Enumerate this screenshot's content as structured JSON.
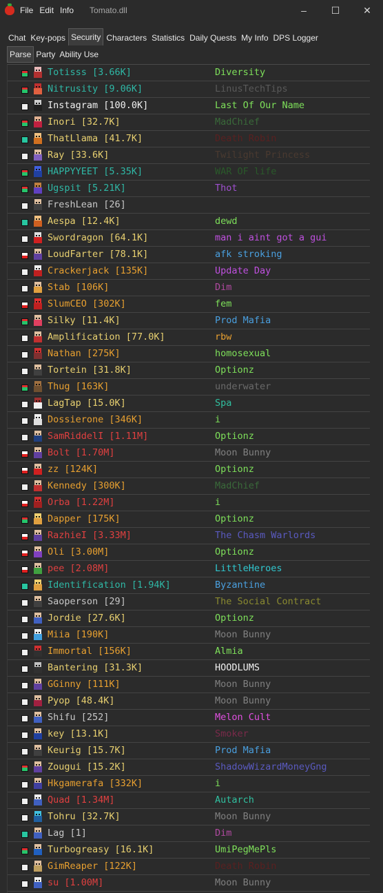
{
  "window": {
    "title": "Tomato.dll",
    "menu": [
      "File",
      "Edit",
      "Info"
    ],
    "controls": [
      "–",
      "☐",
      "✕"
    ]
  },
  "tabs": [
    {
      "label": "Chat"
    },
    {
      "label": "Key-pops"
    },
    {
      "label": "Security",
      "active": true
    },
    {
      "label": "Characters"
    },
    {
      "label": "Statistics"
    },
    {
      "label": "Daily Quests"
    },
    {
      "label": "My Info"
    },
    {
      "label": "DPS Logger"
    }
  ],
  "subtabs": [
    {
      "label": "Parse",
      "active": true
    },
    {
      "label": "Party"
    },
    {
      "label": "Ability Use"
    }
  ],
  "players": [
    {
      "name": "Totisss [3.66K]",
      "name_color": "#2fb8a6",
      "guild": "Diversity",
      "guild_color": "#7ee05a",
      "flag": "green",
      "skin": "#e8b8b8",
      "outfit": "#b03030"
    },
    {
      "name": "Nitrusity [9.06K]",
      "name_color": "#2fb8a6",
      "guild": "LinusTechTips",
      "guild_color": "#5a5a5a",
      "flag": "green",
      "skin": "#c03030",
      "outfit": "#e06040"
    },
    {
      "name": "Instagram [100.0K]",
      "name_color": "#f0f0f0",
      "guild": "Last Of Our Name",
      "guild_color": "#7ee05a",
      "flag": "white",
      "skin": "#d0d0d0",
      "outfit": "#202020"
    },
    {
      "name": "Inori [32.7K]",
      "name_color": "#e8d070",
      "guild": "MadChief",
      "guild_color": "#3a6a3a",
      "flag": "green",
      "skin": "#e0b090",
      "outfit": "#c02040"
    },
    {
      "name": "ThatLlama [41.7K]",
      "name_color": "#e8d070",
      "guild": "Death Robin",
      "guild_color": "#5a2020",
      "flag": "teal",
      "skin": "#f0c080",
      "outfit": "#d07020"
    },
    {
      "name": "Ray [33.6K]",
      "name_color": "#e8d070",
      "guild": "Twilight Princess",
      "guild_color": "#4a3a30",
      "flag": "white",
      "skin": "#e0c0a0",
      "outfit": "#8060c0"
    },
    {
      "name": "HAPPYYEET [5.35K]",
      "name_color": "#2fb8a6",
      "guild": "WAR OF life",
      "guild_color": "#2a5a2a",
      "flag": "green",
      "skin": "#4060e0",
      "outfit": "#2040a0"
    },
    {
      "name": "Ugspit [5.21K]",
      "name_color": "#2fb8a6",
      "guild": "Thot",
      "guild_color": "#a050d0",
      "flag": "green",
      "skin": "#c08040",
      "outfit": "#6040c0"
    },
    {
      "name": "FreshLean [26]",
      "name_color": "#c8c8c8",
      "guild": "",
      "guild_color": "#ffffff",
      "flag": "white",
      "skin": "#e0c0a0",
      "outfit": "#404040"
    },
    {
      "name": "Aespa [12.4K]",
      "name_color": "#e8d070",
      "guild": "dewd",
      "guild_color": "#7ee05a",
      "flag": "teal",
      "skin": "#f0c080",
      "outfit": "#d06020"
    },
    {
      "name": "Swordragon [64.1K]",
      "name_color": "#e8d070",
      "guild": "man i aint got a gui",
      "guild_color": "#c050e0",
      "flag": "white",
      "skin": "#e0e0e0",
      "outfit": "#d02020"
    },
    {
      "name": "LoudFarter [78.1K]",
      "name_color": "#e8d070",
      "guild": "afk stroking",
      "guild_color": "#4aa0e0",
      "flag": "red",
      "skin": "#e0c0a0",
      "outfit": "#6040a0"
    },
    {
      "name": "Crackerjack [135K]",
      "name_color": "#e8a030",
      "guild": "Update Day",
      "guild_color": "#c050e0",
      "flag": "white",
      "skin": "#f0f0f0",
      "outfit": "#c02020"
    },
    {
      "name": "Stab [106K]",
      "name_color": "#e8a030",
      "guild": "Dim",
      "guild_color": "#b04aa0",
      "flag": "white",
      "skin": "#e0c0a0",
      "outfit": "#e0a040"
    },
    {
      "name": "SlumCEO [302K]",
      "name_color": "#e8a030",
      "guild": "fem",
      "guild_color": "#7ee05a",
      "flag": "red",
      "skin": "#e03030",
      "outfit": "#c02020"
    },
    {
      "name": "Silky [11.4K]",
      "name_color": "#e8d070",
      "guild": "Prod Mafia",
      "guild_color": "#4aa0e0",
      "flag": "green",
      "skin": "#e0c0a0",
      "outfit": "#e04060"
    },
    {
      "name": "Amplification [77.0K]",
      "name_color": "#e8d070",
      "guild": "rbw",
      "guild_color": "#e8a030",
      "flag": "white",
      "skin": "#e0c0a0",
      "outfit": "#c03030"
    },
    {
      "name": "Nathan [275K]",
      "name_color": "#e8a030",
      "guild": "homosexual",
      "guild_color": "#7ee05a",
      "flag": "white",
      "skin": "#d03030",
      "outfit": "#803030"
    },
    {
      "name": "Tortein [31.8K]",
      "name_color": "#e8d070",
      "guild": "Optionz",
      "guild_color": "#7ee05a",
      "flag": "white",
      "skin": "#e0c0a0",
      "outfit": "#404040"
    },
    {
      "name": "Thug [163K]",
      "name_color": "#e8a030",
      "guild": "underwater",
      "guild_color": "#6a6a6a",
      "flag": "green",
      "skin": "#a07040",
      "outfit": "#705030"
    },
    {
      "name": "LagTap [15.0K]",
      "name_color": "#e8d070",
      "guild": "Spa",
      "guild_color": "#30c0a0",
      "flag": "white",
      "skin": "#a03030",
      "outfit": "#f0f0f0"
    },
    {
      "name": "Dossierone [346K]",
      "name_color": "#e8a030",
      "guild": "i",
      "guild_color": "#7ee05a",
      "flag": "white",
      "skin": "#f0f0f0",
      "outfit": "#e0e0e0"
    },
    {
      "name": "SamRiddelI [1.11M]",
      "name_color": "#e04040",
      "guild": "Optionz",
      "guild_color": "#7ee05a",
      "flag": "white",
      "skin": "#e0c0a0",
      "outfit": "#204080"
    },
    {
      "name": "Bolt [1.70M]",
      "name_color": "#e04040",
      "guild": "Moon Bunny",
      "guild_color": "#808080",
      "flag": "red",
      "skin": "#e0c0a0",
      "outfit": "#6040a0"
    },
    {
      "name": "zz [124K]",
      "name_color": "#e8a030",
      "guild": "Optionz",
      "guild_color": "#7ee05a",
      "flag": "red",
      "skin": "#e0c0a0",
      "outfit": "#d02020"
    },
    {
      "name": "Kennedy [300K]",
      "name_color": "#e8a030",
      "guild": "MadChief",
      "guild_color": "#3a6a3a",
      "flag": "white",
      "skin": "#e0c0a0",
      "outfit": "#c03030"
    },
    {
      "name": "Orba [1.22M]",
      "name_color": "#e04040",
      "guild": "i",
      "guild_color": "#7ee05a",
      "flag": "red",
      "skin": "#d03030",
      "outfit": "#a02020"
    },
    {
      "name": "Dapper [175K]",
      "name_color": "#e8a030",
      "guild": "Optionz",
      "guild_color": "#7ee05a",
      "flag": "green",
      "skin": "#f0d070",
      "outfit": "#e0a040"
    },
    {
      "name": "RazhieI [3.33M]",
      "name_color": "#e04040",
      "guild": "The Chasm Warlords",
      "guild_color": "#5a5ac0",
      "flag": "red",
      "skin": "#e0c0a0",
      "outfit": "#6040a0"
    },
    {
      "name": "Oli [3.00M]",
      "name_color": "#e8a030",
      "guild": "Optionz",
      "guild_color": "#7ee05a",
      "flag": "red",
      "skin": "#e0c0a0",
      "outfit": "#8040c0"
    },
    {
      "name": "pee [2.08M]",
      "name_color": "#e04040",
      "guild": "LittleHeroes",
      "guild_color": "#30c8d0",
      "flag": "red",
      "skin": "#e0c0a0",
      "outfit": "#40a040"
    },
    {
      "name": "Identification [1.94K]",
      "name_color": "#2fb8a6",
      "guild": "Byzantine",
      "guild_color": "#4aa0e0",
      "flag": "teal",
      "skin": "#f0d070",
      "outfit": "#e0a040"
    },
    {
      "name": "Saoperson [29]",
      "name_color": "#c8c8c8",
      "guild": "The Social Contract",
      "guild_color": "#8a8a30",
      "flag": "white",
      "skin": "#e0c0a0",
      "outfit": "#404040"
    },
    {
      "name": "Jordie [27.6K]",
      "name_color": "#e8d070",
      "guild": "Optionz",
      "guild_color": "#7ee05a",
      "flag": "white",
      "skin": "#e0c0a0",
      "outfit": "#4060c0"
    },
    {
      "name": "Miia [190K]",
      "name_color": "#e8a030",
      "guild": "Moon Bunny",
      "guild_color": "#808080",
      "flag": "white",
      "skin": "#f0f0f0",
      "outfit": "#40a0e0"
    },
    {
      "name": "Immortal [156K]",
      "name_color": "#e8a030",
      "guild": "Almia",
      "guild_color": "#7ee05a",
      "flag": "white",
      "skin": "#d03030",
      "outfit": "#303030"
    },
    {
      "name": "Bantering [31.3K]",
      "name_color": "#e8d070",
      "guild": "HOODLUMS",
      "guild_color": "#f0f0f0",
      "flag": "white",
      "skin": "#c0c0c0",
      "outfit": "#303030"
    },
    {
      "name": "GGinny [111K]",
      "name_color": "#e8a030",
      "guild": "Moon Bunny",
      "guild_color": "#808080",
      "flag": "white",
      "skin": "#e0c0a0",
      "outfit": "#6040a0"
    },
    {
      "name": "Pyop [48.4K]",
      "name_color": "#e8d070",
      "guild": "Moon Bunny",
      "guild_color": "#808080",
      "flag": "white",
      "skin": "#e0c0a0",
      "outfit": "#a02040"
    },
    {
      "name": "Shifu [252]",
      "name_color": "#c8c8c8",
      "guild": "Melon Cult",
      "guild_color": "#e050e0",
      "flag": "white",
      "skin": "#e0c0a0",
      "outfit": "#4060c0"
    },
    {
      "name": "key [13.1K]",
      "name_color": "#e8d070",
      "guild": "Smoker",
      "guild_color": "#7a2a4a",
      "flag": "white",
      "skin": "#e0c0a0",
      "outfit": "#2040a0"
    },
    {
      "name": "Keurig [15.7K]",
      "name_color": "#e8d070",
      "guild": "Prod Mafia",
      "guild_color": "#4aa0e0",
      "flag": "white",
      "skin": "#e0c0a0",
      "outfit": "#404040"
    },
    {
      "name": "Zougui [15.2K]",
      "name_color": "#e8d070",
      "guild": "ShadowWizardMoneyGng",
      "guild_color": "#5a5ac0",
      "flag": "green",
      "skin": "#e0c0a0",
      "outfit": "#6040a0"
    },
    {
      "name": "Hkgamerafa [332K]",
      "name_color": "#e8a030",
      "guild": "i",
      "guild_color": "#7ee05a",
      "flag": "white",
      "skin": "#e0c0a0",
      "outfit": "#4040a0"
    },
    {
      "name": "Quad [1.34M]",
      "name_color": "#e04040",
      "guild": "Autarch",
      "guild_color": "#30c0a0",
      "flag": "white",
      "skin": "#f0f0f0",
      "outfit": "#4060c0"
    },
    {
      "name": "Tohru [32.7K]",
      "name_color": "#e8d070",
      "guild": "Moon Bunny",
      "guild_color": "#808080",
      "flag": "white",
      "skin": "#40c0e0",
      "outfit": "#2060a0"
    },
    {
      "name": "Lag [1]",
      "name_color": "#c8c8c8",
      "guild": "Dim",
      "guild_color": "#b04aa0",
      "flag": "teal",
      "skin": "#e0c0a0",
      "outfit": "#4060c0"
    },
    {
      "name": "Turbogreasy [16.1K]",
      "name_color": "#e8d070",
      "guild": "UmiPegMePls",
      "guild_color": "#7ee05a",
      "flag": "green",
      "skin": "#e0c0a0",
      "outfit": "#2060c0"
    },
    {
      "name": "GimReaper [122K]",
      "name_color": "#e8a030",
      "guild": "Death Robin",
      "guild_color": "#5a2020",
      "flag": "white",
      "skin": "#e0c0a0",
      "outfit": "#c0a060"
    },
    {
      "name": "su [1.00M]",
      "name_color": "#e04040",
      "guild": "Moon Bunny",
      "guild_color": "#808080",
      "flag": "white",
      "skin": "#f0f0f0",
      "outfit": "#4060c0"
    }
  ]
}
